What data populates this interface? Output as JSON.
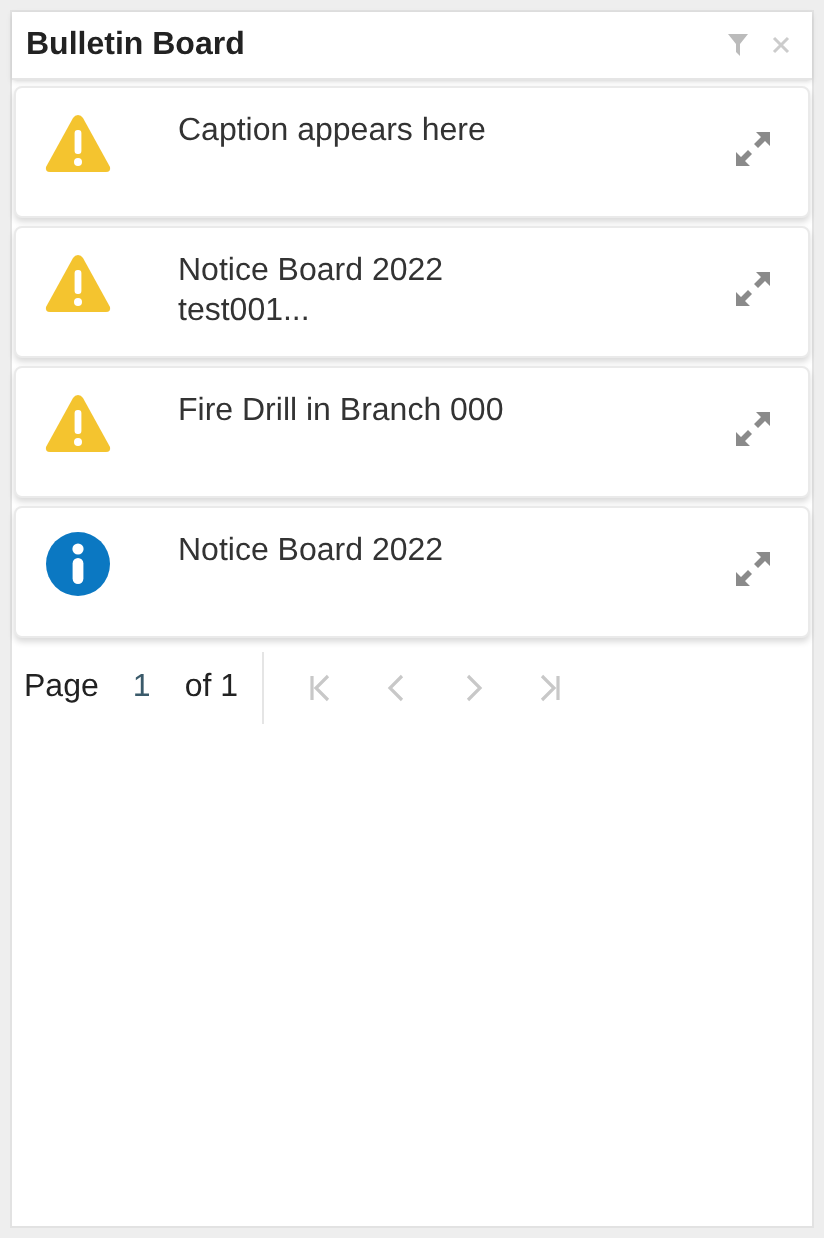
{
  "panel": {
    "title": "Bulletin Board"
  },
  "notices": [
    {
      "kind": "warning",
      "lines": [
        "Caption appears here"
      ]
    },
    {
      "kind": "warning",
      "lines": [
        "Notice Board 2022",
        "test001..."
      ]
    },
    {
      "kind": "warning",
      "lines": [
        "Fire Drill in Branch 000"
      ]
    },
    {
      "kind": "info",
      "lines": [
        "Notice Board 2022"
      ]
    }
  ],
  "pager": {
    "label": "Page",
    "page": "1",
    "total": "of 1",
    "buttons": [
      {
        "kind": "first",
        "disabled": true
      },
      {
        "kind": "prev",
        "disabled": true
      },
      {
        "kind": "next",
        "disabled": true
      },
      {
        "kind": "last",
        "disabled": true
      }
    ]
  }
}
